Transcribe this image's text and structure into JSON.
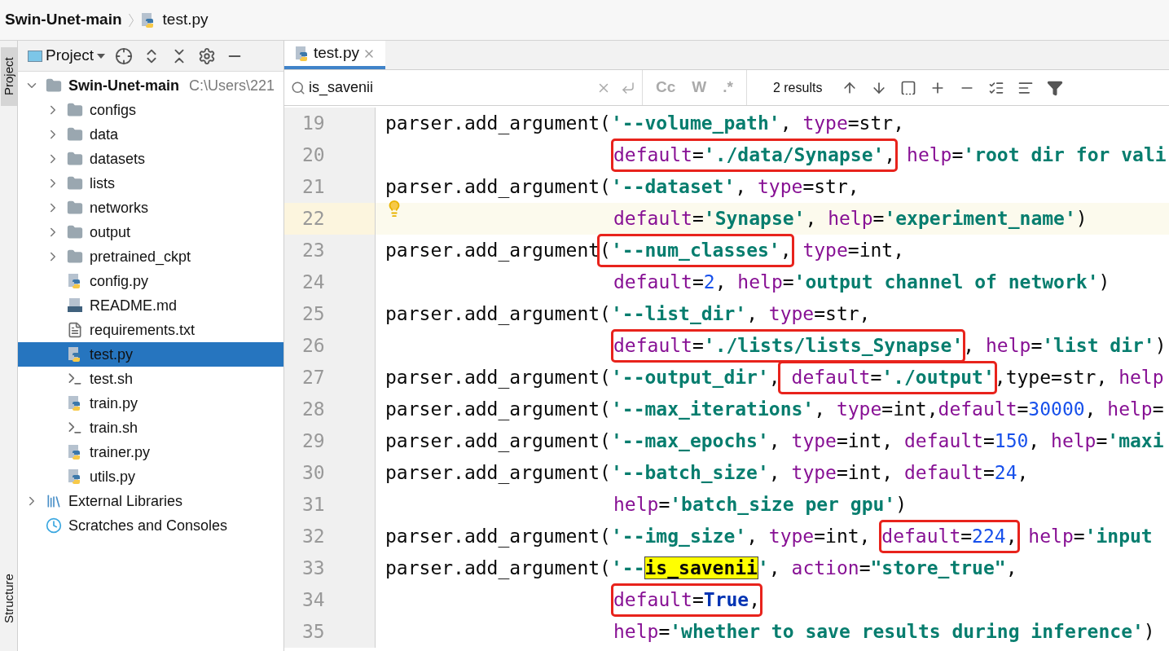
{
  "breadcrumb": {
    "project": "Swin-Unet-main",
    "file": "test.py"
  },
  "side_strip": {
    "top": "Project",
    "bottom": "Structure"
  },
  "project_panel": {
    "title": "Project",
    "tree": [
      {
        "label": "Swin-Unet-main",
        "path": "C:\\Users\\221",
        "kind": "root",
        "expanded": true,
        "selected": false,
        "children": [
          {
            "label": "configs",
            "kind": "folder",
            "expanded": false,
            "selected": false
          },
          {
            "label": "data",
            "kind": "folder",
            "expanded": false,
            "selected": false
          },
          {
            "label": "datasets",
            "kind": "folder",
            "expanded": false,
            "selected": false
          },
          {
            "label": "lists",
            "kind": "folder",
            "expanded": false,
            "selected": false
          },
          {
            "label": "networks",
            "kind": "folder",
            "expanded": false,
            "selected": false
          },
          {
            "label": "output",
            "kind": "folder",
            "expanded": false,
            "selected": false
          },
          {
            "label": "pretrained_ckpt",
            "kind": "folder",
            "expanded": false,
            "selected": false
          },
          {
            "label": "config.py",
            "kind": "python",
            "selected": false
          },
          {
            "label": "README.md",
            "kind": "markdown",
            "selected": false
          },
          {
            "label": "requirements.txt",
            "kind": "text",
            "selected": false
          },
          {
            "label": "test.py",
            "kind": "python",
            "selected": true
          },
          {
            "label": "test.sh",
            "kind": "shell",
            "selected": false
          },
          {
            "label": "train.py",
            "kind": "python",
            "selected": false
          },
          {
            "label": "train.sh",
            "kind": "shell",
            "selected": false
          },
          {
            "label": "trainer.py",
            "kind": "python",
            "selected": false
          },
          {
            "label": "utils.py",
            "kind": "python",
            "selected": false
          }
        ]
      },
      {
        "label": "External Libraries",
        "kind": "libraries",
        "expanded": false,
        "selected": false
      },
      {
        "label": "Scratches and Consoles",
        "kind": "scratches",
        "selected": false
      }
    ]
  },
  "tabs": [
    {
      "label": "test.py",
      "selected": true
    }
  ],
  "search": {
    "query": "is_savenii",
    "options": [
      "Cc",
      "W",
      ".*"
    ],
    "results": "2 results"
  },
  "code": [
    {
      "number": "19",
      "indented": false,
      "current": false,
      "segments": [
        {
          "boxed": false,
          "tokens": [
            {
              "kind": "plain",
              "text": "parser.add_argument("
            },
            {
              "kind": "str",
              "text": "'--volume_path'"
            },
            {
              "kind": "plain",
              "text": ", "
            },
            {
              "kind": "kw",
              "text": "type"
            },
            {
              "kind": "plain",
              "text": "=str,"
            }
          ]
        }
      ]
    },
    {
      "number": "20",
      "indented": true,
      "current": false,
      "segments": [
        {
          "boxed": true,
          "tokens": [
            {
              "kind": "kw",
              "text": "default"
            },
            {
              "kind": "plain",
              "text": "="
            },
            {
              "kind": "str",
              "text": "'./data/Synapse'"
            },
            {
              "kind": "plain",
              "text": ","
            }
          ]
        },
        {
          "boxed": false,
          "tokens": [
            {
              "kind": "kw",
              "text": " help"
            },
            {
              "kind": "plain",
              "text": "="
            },
            {
              "kind": "str",
              "text": "'root dir for vali"
            }
          ]
        }
      ]
    },
    {
      "number": "21",
      "indented": false,
      "current": false,
      "segments": [
        {
          "boxed": false,
          "tokens": [
            {
              "kind": "plain",
              "text": "parser.add_argument("
            },
            {
              "kind": "str",
              "text": "'--dataset'"
            },
            {
              "kind": "plain",
              "text": ", "
            },
            {
              "kind": "kw",
              "text": "type"
            },
            {
              "kind": "plain",
              "text": "=str,"
            }
          ]
        }
      ]
    },
    {
      "number": "22",
      "indented": true,
      "current": true,
      "segments": [
        {
          "boxed": false,
          "tokens": [
            {
              "kind": "kw",
              "text": "default"
            },
            {
              "kind": "plain",
              "text": "="
            },
            {
              "kind": "str",
              "text": "'Synapse'"
            },
            {
              "kind": "plain",
              "text": ", "
            },
            {
              "kind": "kw",
              "text": "help"
            },
            {
              "kind": "plain",
              "text": "="
            },
            {
              "kind": "str",
              "text": "'experiment_name'"
            },
            {
              "kind": "plain",
              "text": ")"
            }
          ]
        }
      ]
    },
    {
      "number": "23",
      "indented": false,
      "current": false,
      "segments": [
        {
          "boxed": false,
          "tokens": [
            {
              "kind": "plain",
              "text": "parser.add_argument"
            }
          ]
        },
        {
          "boxed": true,
          "tokens": [
            {
              "kind": "plain",
              "text": "("
            },
            {
              "kind": "str",
              "text": "'--num_classes'"
            },
            {
              "kind": "plain",
              "text": ","
            }
          ]
        },
        {
          "boxed": false,
          "tokens": [
            {
              "kind": "kw",
              "text": " type"
            },
            {
              "kind": "plain",
              "text": "=int,"
            }
          ]
        }
      ]
    },
    {
      "number": "24",
      "indented": true,
      "current": false,
      "segments": [
        {
          "boxed": false,
          "tokens": [
            {
              "kind": "kw",
              "text": "default"
            },
            {
              "kind": "plain",
              "text": "="
            },
            {
              "kind": "num",
              "text": "2"
            },
            {
              "kind": "plain",
              "text": ", "
            },
            {
              "kind": "kw",
              "text": "help"
            },
            {
              "kind": "plain",
              "text": "="
            },
            {
              "kind": "str",
              "text": "'output channel of network'"
            },
            {
              "kind": "plain",
              "text": ")"
            }
          ]
        }
      ]
    },
    {
      "number": "25",
      "indented": false,
      "current": false,
      "segments": [
        {
          "boxed": false,
          "tokens": [
            {
              "kind": "plain",
              "text": "parser.add_argument("
            },
            {
              "kind": "str",
              "text": "'--list_dir'"
            },
            {
              "kind": "plain",
              "text": ", "
            },
            {
              "kind": "kw",
              "text": "type"
            },
            {
              "kind": "plain",
              "text": "=str,"
            }
          ]
        }
      ]
    },
    {
      "number": "26",
      "indented": true,
      "current": false,
      "segments": [
        {
          "boxed": true,
          "tokens": [
            {
              "kind": "kw",
              "text": "default"
            },
            {
              "kind": "plain",
              "text": "="
            },
            {
              "kind": "str",
              "text": "'./lists/lists_Synapse'"
            }
          ]
        },
        {
          "boxed": false,
          "tokens": [
            {
              "kind": "plain",
              "text": ", "
            },
            {
              "kind": "kw",
              "text": "help"
            },
            {
              "kind": "plain",
              "text": "="
            },
            {
              "kind": "str",
              "text": "'list dir'"
            },
            {
              "kind": "plain",
              "text": ")"
            }
          ]
        }
      ]
    },
    {
      "number": "27",
      "indented": false,
      "current": false,
      "segments": [
        {
          "boxed": false,
          "tokens": [
            {
              "kind": "plain",
              "text": "parser.add_argument("
            },
            {
              "kind": "str",
              "text": "'--output_dir'"
            },
            {
              "kind": "plain",
              "text": ","
            }
          ]
        },
        {
          "boxed": true,
          "tokens": [
            {
              "kind": "kw",
              "text": " default"
            },
            {
              "kind": "plain",
              "text": "="
            },
            {
              "kind": "str",
              "text": "'./output'"
            }
          ]
        },
        {
          "boxed": false,
          "tokens": [
            {
              "kind": "plain",
              "text": ",type=str, "
            },
            {
              "kind": "kw",
              "text": "help"
            }
          ]
        }
      ]
    },
    {
      "number": "28",
      "indented": false,
      "current": false,
      "segments": [
        {
          "boxed": false,
          "tokens": [
            {
              "kind": "plain",
              "text": "parser.add_argument("
            },
            {
              "kind": "str",
              "text": "'--max_iterations'"
            },
            {
              "kind": "plain",
              "text": ", "
            },
            {
              "kind": "kw",
              "text": "type"
            },
            {
              "kind": "plain",
              "text": "=int,"
            },
            {
              "kind": "kw",
              "text": "default"
            },
            {
              "kind": "plain",
              "text": "="
            },
            {
              "kind": "num",
              "text": "30000"
            },
            {
              "kind": "plain",
              "text": ", "
            },
            {
              "kind": "kw",
              "text": "help"
            },
            {
              "kind": "plain",
              "text": "="
            }
          ]
        }
      ]
    },
    {
      "number": "29",
      "indented": false,
      "current": false,
      "segments": [
        {
          "boxed": false,
          "tokens": [
            {
              "kind": "plain",
              "text": "parser.add_argument("
            },
            {
              "kind": "str",
              "text": "'--max_epochs'"
            },
            {
              "kind": "plain",
              "text": ", "
            },
            {
              "kind": "kw",
              "text": "type"
            },
            {
              "kind": "plain",
              "text": "=int, "
            },
            {
              "kind": "kw",
              "text": "default"
            },
            {
              "kind": "plain",
              "text": "="
            },
            {
              "kind": "num",
              "text": "150"
            },
            {
              "kind": "plain",
              "text": ", "
            },
            {
              "kind": "kw",
              "text": "help"
            },
            {
              "kind": "plain",
              "text": "="
            },
            {
              "kind": "str",
              "text": "'maxi"
            }
          ]
        }
      ]
    },
    {
      "number": "30",
      "indented": false,
      "current": false,
      "segments": [
        {
          "boxed": false,
          "tokens": [
            {
              "kind": "plain",
              "text": "parser.add_argument("
            },
            {
              "kind": "str",
              "text": "'--batch_size'"
            },
            {
              "kind": "plain",
              "text": ", "
            },
            {
              "kind": "kw",
              "text": "type"
            },
            {
              "kind": "plain",
              "text": "=int, "
            },
            {
              "kind": "kw",
              "text": "default"
            },
            {
              "kind": "plain",
              "text": "="
            },
            {
              "kind": "num",
              "text": "24"
            },
            {
              "kind": "plain",
              "text": ","
            }
          ]
        }
      ]
    },
    {
      "number": "31",
      "indented": true,
      "current": false,
      "segments": [
        {
          "boxed": false,
          "tokens": [
            {
              "kind": "kw",
              "text": "help"
            },
            {
              "kind": "plain",
              "text": "="
            },
            {
              "kind": "str",
              "text": "'batch_size per gpu'"
            },
            {
              "kind": "plain",
              "text": ")"
            }
          ]
        }
      ]
    },
    {
      "number": "32",
      "indented": false,
      "current": false,
      "segments": [
        {
          "boxed": false,
          "tokens": [
            {
              "kind": "plain",
              "text": "parser.add_argument("
            },
            {
              "kind": "str",
              "text": "'--img_size'"
            },
            {
              "kind": "plain",
              "text": ", "
            },
            {
              "kind": "kw",
              "text": "type"
            },
            {
              "kind": "plain",
              "text": "=int, "
            }
          ]
        },
        {
          "boxed": true,
          "tokens": [
            {
              "kind": "kw",
              "text": "default"
            },
            {
              "kind": "plain",
              "text": "="
            },
            {
              "kind": "num",
              "text": "224"
            },
            {
              "kind": "plain",
              "text": ","
            }
          ]
        },
        {
          "boxed": false,
          "tokens": [
            {
              "kind": "kw",
              "text": " help"
            },
            {
              "kind": "plain",
              "text": "="
            },
            {
              "kind": "str",
              "text": "'input"
            }
          ]
        }
      ]
    },
    {
      "number": "33",
      "indented": false,
      "current": false,
      "segments": [
        {
          "boxed": false,
          "tokens": [
            {
              "kind": "plain",
              "text": "parser.add_argument("
            },
            {
              "kind": "str",
              "text": "'--"
            },
            {
              "kind": "match",
              "text": "is_savenii"
            },
            {
              "kind": "str",
              "text": "'"
            },
            {
              "kind": "plain",
              "text": ", "
            },
            {
              "kind": "kw",
              "text": "action"
            },
            {
              "kind": "plain",
              "text": "="
            },
            {
              "kind": "str",
              "text": "\"store_true\""
            },
            {
              "kind": "plain",
              "text": ","
            }
          ]
        }
      ]
    },
    {
      "number": "34",
      "indented": true,
      "current": false,
      "segments": [
        {
          "boxed": true,
          "tokens": [
            {
              "kind": "kw",
              "text": "default"
            },
            {
              "kind": "plain",
              "text": "="
            },
            {
              "kind": "const",
              "text": "True"
            },
            {
              "kind": "plain",
              "text": ","
            }
          ]
        }
      ]
    },
    {
      "number": "35",
      "indented": true,
      "current": false,
      "segments": [
        {
          "boxed": false,
          "tokens": [
            {
              "kind": "kw",
              "text": "help"
            },
            {
              "kind": "plain",
              "text": "="
            },
            {
              "kind": "str",
              "text": "'whether to save results during inference'"
            },
            {
              "kind": "plain",
              "text": ")"
            }
          ]
        }
      ]
    }
  ]
}
